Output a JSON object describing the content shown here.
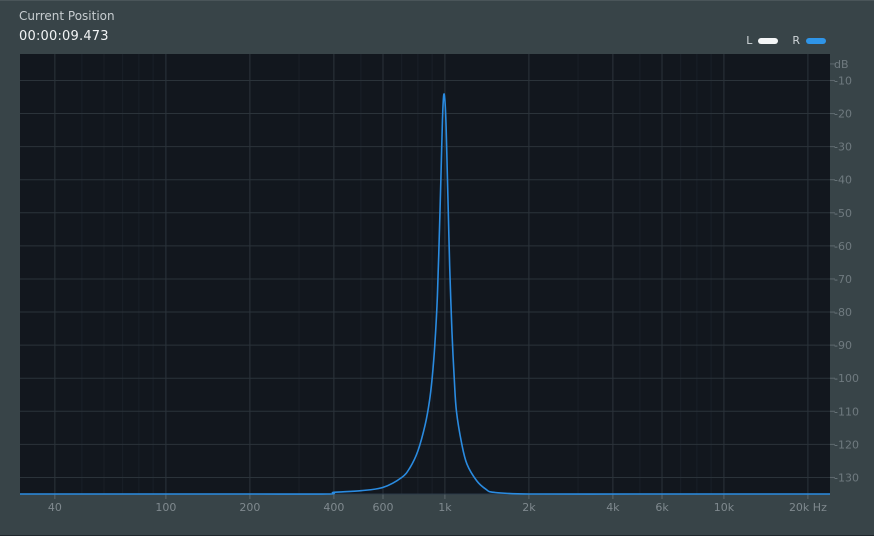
{
  "header": {
    "position_label": "Current Position",
    "position_value": "00:00:09.473"
  },
  "legend": {
    "items": [
      {
        "label": "L",
        "color": "#f4f6f7"
      },
      {
        "label": "R",
        "color": "#2f95e8"
      }
    ]
  },
  "colors": {
    "plot_background": "#12171e",
    "grid": "#2b333a",
    "curve": "#2a8be0"
  },
  "chart_data": {
    "type": "line",
    "title": "",
    "xlabel": "Hz",
    "ylabel": "dB",
    "x_scale": "log",
    "xlim": [
      30,
      24000
    ],
    "ylim": [
      -135,
      -2
    ],
    "x_ticks": [
      40,
      100,
      200,
      400,
      600,
      1000,
      2000,
      4000,
      6000,
      10000,
      20000
    ],
    "x_tick_labels": [
      "40",
      "100",
      "200",
      "400",
      "600",
      "1k",
      "2k",
      "4k",
      "6k",
      "10k",
      "20k Hz"
    ],
    "y_ticks": [
      -5,
      -10,
      -20,
      -30,
      -40,
      -50,
      -60,
      -70,
      -80,
      -90,
      -100,
      -110,
      -120,
      -130
    ],
    "y_tick_labels": [
      "dB",
      "-10",
      "-20",
      "-30",
      "-40",
      "-50",
      "-60",
      "-70",
      "-80",
      "-90",
      "-100",
      "-110",
      "-120",
      "-130"
    ],
    "grid": true,
    "series": [
      {
        "x": [
          30,
          100,
          200,
          380,
          400,
          500,
          600,
          700,
          750,
          800,
          850,
          880,
          900,
          920,
          940,
          960,
          970,
          980,
          990,
          1000,
          1010,
          1020,
          1030,
          1040,
          1060,
          1080,
          1100,
          1150,
          1200,
          1300,
          1400,
          1500,
          2000,
          5000,
          10000,
          24000
        ],
        "y": [
          -135,
          -135,
          -135,
          -135,
          -134.5,
          -134,
          -133,
          -130,
          -127,
          -122,
          -114,
          -107,
          -100,
          -90,
          -75,
          -50,
          -36,
          -22,
          -14.5,
          -16,
          -24,
          -38,
          -52,
          -66,
          -86,
          -100,
          -110,
          -120,
          -126,
          -131,
          -133.5,
          -134.5,
          -135,
          -135,
          -135,
          -135
        ]
      }
    ]
  }
}
